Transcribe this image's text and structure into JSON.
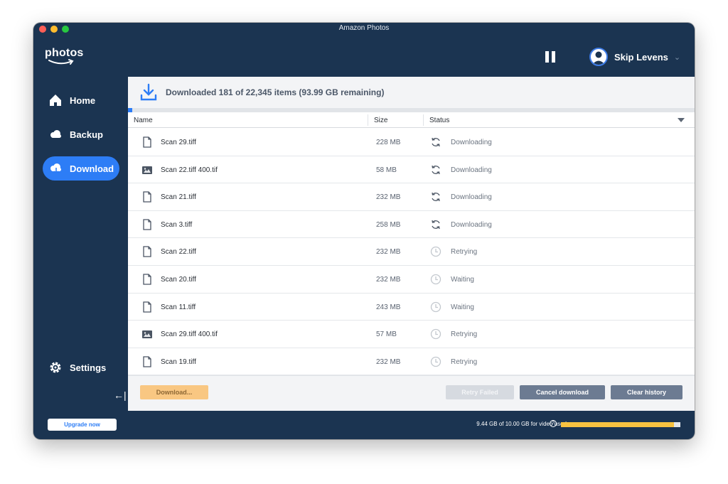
{
  "window": {
    "title": "Amazon Photos"
  },
  "logo": {
    "text": "photos"
  },
  "user": {
    "name": "Skip Levens"
  },
  "sidebar": {
    "items": [
      {
        "label": "Home",
        "icon": "home-icon",
        "active": false
      },
      {
        "label": "Backup",
        "icon": "cloud-icon",
        "active": false
      },
      {
        "label": "Download",
        "icon": "cloud-download-icon",
        "active": true
      }
    ],
    "settings_label": "Settings",
    "collapse_icon": "←|"
  },
  "download": {
    "status_text": "Downloaded 181 of 22,345 items (93.99 GB remaining)",
    "progress_fraction": 0.0081
  },
  "table": {
    "columns": {
      "name": "Name",
      "size": "Size",
      "status": "Status"
    },
    "rows": [
      {
        "name": "Scan 29.tiff",
        "size": "228 MB",
        "status": "Downloading",
        "file_icon": "document-icon",
        "status_icon": "sync-icon"
      },
      {
        "name": "Scan 22.tiff 400.tif",
        "size": "58 MB",
        "status": "Downloading",
        "file_icon": "image-icon",
        "status_icon": "sync-icon"
      },
      {
        "name": "Scan 21.tiff",
        "size": "232 MB",
        "status": "Downloading",
        "file_icon": "document-icon",
        "status_icon": "sync-icon"
      },
      {
        "name": "Scan 3.tiff",
        "size": "258 MB",
        "status": "Downloading",
        "file_icon": "document-icon",
        "status_icon": "sync-icon"
      },
      {
        "name": "Scan 22.tiff",
        "size": "232 MB",
        "status": "Retrying",
        "file_icon": "document-icon",
        "status_icon": "clock-icon"
      },
      {
        "name": "Scan 20.tiff",
        "size": "232 MB",
        "status": "Waiting",
        "file_icon": "document-icon",
        "status_icon": "clock-icon"
      },
      {
        "name": "Scan 11.tiff",
        "size": "243 MB",
        "status": "Waiting",
        "file_icon": "document-icon",
        "status_icon": "clock-icon"
      },
      {
        "name": "Scan 29.tiff 400.tif",
        "size": "57 MB",
        "status": "Retrying",
        "file_icon": "image-icon",
        "status_icon": "clock-icon"
      },
      {
        "name": "Scan 19.tiff",
        "size": "232 MB",
        "status": "Retrying",
        "file_icon": "document-icon",
        "status_icon": "clock-icon"
      }
    ]
  },
  "actions": {
    "download_label": "Download...",
    "retry_label": "Retry Failed",
    "cancel_label": "Cancel download",
    "clear_label": "Clear history"
  },
  "footer": {
    "upgrade_label": "Upgrade now",
    "usage_text": "9.44 GB of 10.00 GB for video used",
    "help_glyph": "?",
    "usage_fraction": 0.944
  },
  "colors": {
    "window_bg": "#1b3451",
    "accent": "#2d7df6",
    "download_button": "#f9c782",
    "usage_bar": "#f7c240"
  }
}
